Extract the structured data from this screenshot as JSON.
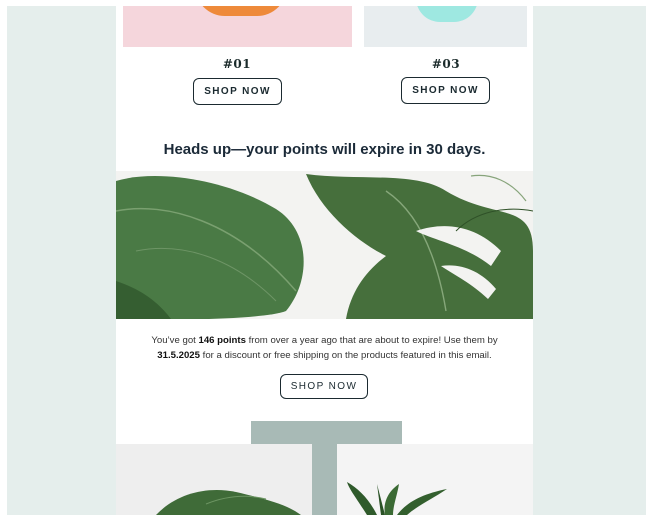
{
  "products": [
    {
      "number": "#01",
      "button": "SHOP NOW"
    },
    {
      "number": "#03",
      "button": "SHOP NOW"
    }
  ],
  "headline": "Heads up—your points will expire in 30 days.",
  "message": {
    "part1": "You’ve got ",
    "points": "146 points",
    "part2": " from over a year ago that are about to expire! Use them by",
    "date": "31.5.2025",
    "part3": " for a discount or free shipping on the products featured in this email."
  },
  "cta": "SHOP NOW",
  "colors": {
    "background": "#e5eeec",
    "text_dark": "#1b2a38",
    "accent_sage": "#a8bab6",
    "leaf_green": "#3f6b3a"
  }
}
